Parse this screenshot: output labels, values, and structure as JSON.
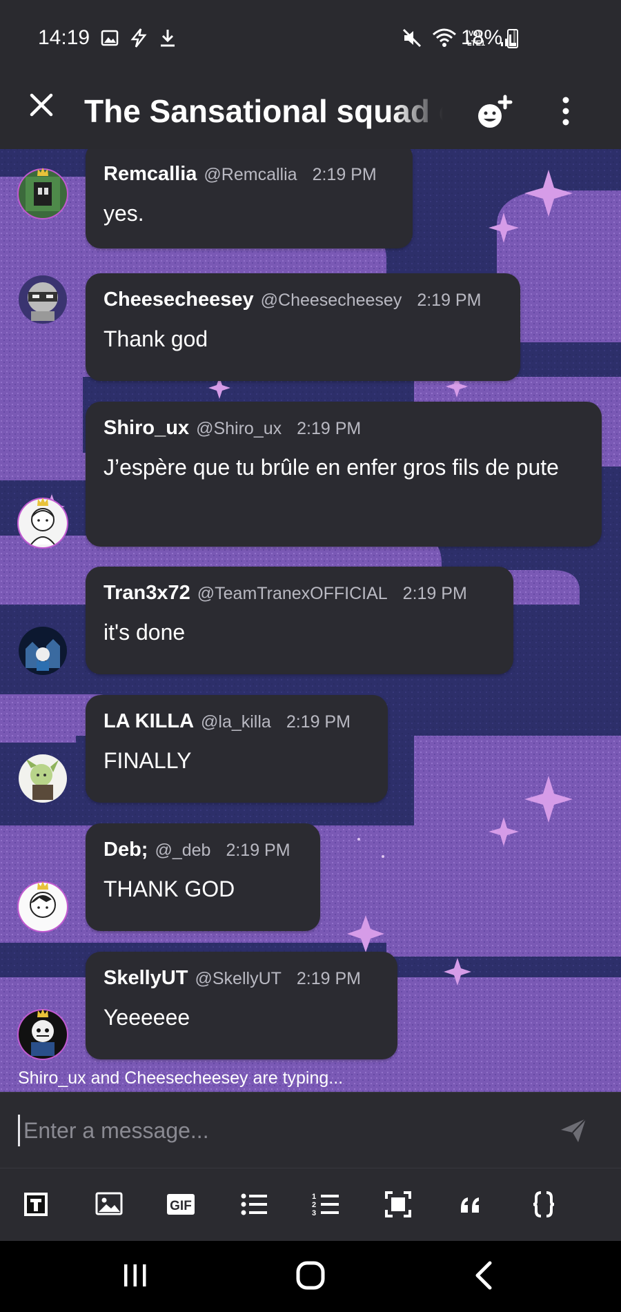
{
  "status_bar": {
    "time": "14:19",
    "battery": "18%",
    "icons": [
      "image-icon",
      "bolt-icon",
      "download-icon",
      "mute-icon",
      "wifi-icon",
      "volte-icon",
      "signal-icon",
      "battery-icon"
    ]
  },
  "header": {
    "title": "The Sansational squad c",
    "icons": [
      "close-icon",
      "add-member-icon",
      "more-options-icon"
    ]
  },
  "messages": [
    {
      "name": "Remcallia",
      "handle": "@Remcallia",
      "time": "2:19 PM",
      "text": "yes."
    },
    {
      "name": "Cheesecheesey",
      "handle": "@Cheesecheesey",
      "time": "2:19 PM",
      "text": "Thank god"
    },
    {
      "name": "Shiro_ux",
      "handle": "@Shiro_ux",
      "time": "2:19 PM",
      "text": "J’espère que tu brûle en enfer gros fils de pute"
    },
    {
      "name": "Tran3x72",
      "handle": "@TeamTranexOFFICIAL",
      "time": "2:19 PM",
      "text": "it's done"
    },
    {
      "name": "LA KILLA",
      "handle": "@la_killa",
      "time": "2:19 PM",
      "text": "FINALLY"
    },
    {
      "name": "Deb;",
      "handle": "@_deb",
      "time": "2:19 PM",
      "text": "THANK GOD"
    },
    {
      "name": "SkellyUT",
      "handle": "@SkellyUT",
      "time": "2:19 PM",
      "text": "Yeeeeee"
    }
  ],
  "typing_indicator": "Shiro_ux and Cheesecheesey are typing...",
  "composer": {
    "placeholder": "Enter a message...",
    "value": ""
  },
  "toolbar": {
    "gif_label": "GIF",
    "tools": [
      "text-format-icon",
      "image-icon",
      "gif-icon",
      "bullet-list-icon",
      "numbered-list-icon",
      "spoiler-icon",
      "quote-icon",
      "code-block-icon"
    ]
  },
  "colors": {
    "background_dark": "#2b2b30",
    "bubble": "#2b2b31",
    "chat_bg_navy": "#2d2f6a",
    "chat_bg_purple": "#7a59b5",
    "accent_pink": "#c05ad0"
  }
}
